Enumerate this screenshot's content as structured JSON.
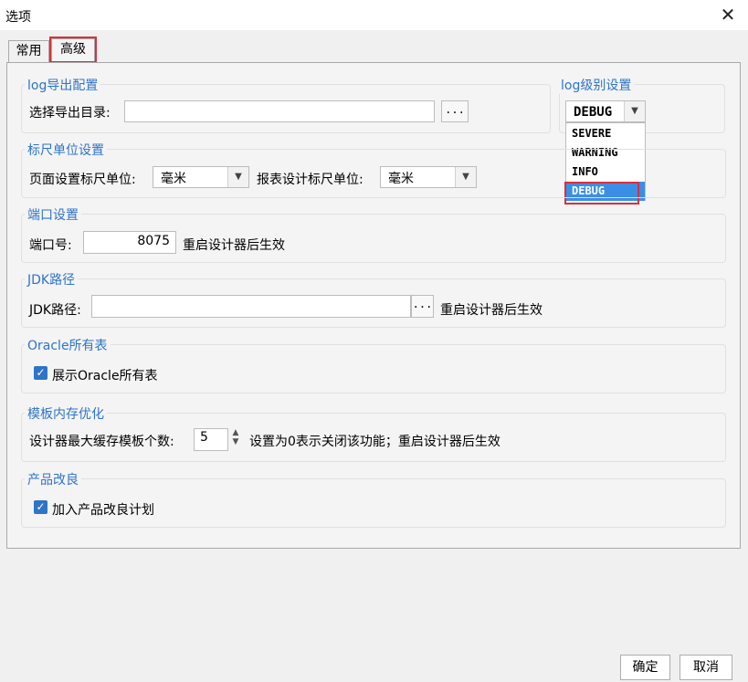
{
  "window": {
    "title": "选项",
    "close_glyph": "✕"
  },
  "tabs": [
    {
      "label": "常用"
    },
    {
      "label": "高级"
    }
  ],
  "log_export": {
    "title": "log导出配置",
    "dir_label": "选择导出目录:",
    "dir_value": "",
    "browse": "..."
  },
  "log_level": {
    "title": "log级别设置",
    "selected": "DEBUG",
    "options": [
      "SEVERE",
      "WARNING",
      "INFO",
      "DEBUG"
    ]
  },
  "ruler": {
    "title": "标尺单位设置",
    "page_label": "页面设置标尺单位:",
    "page_value": "毫米",
    "report_label": "报表设计标尺单位:",
    "report_value": "毫米"
  },
  "port": {
    "title": "端口设置",
    "label": "端口号:",
    "value": "8075",
    "note": "重启设计器后生效"
  },
  "jdk": {
    "title": "JDK路径",
    "label": "JDK路径:",
    "value": "",
    "browse": "...",
    "note": "重启设计器后生效"
  },
  "oracle": {
    "title": "Oracle所有表",
    "checkbox_label": "展示Oracle所有表",
    "checked": true
  },
  "template_mem": {
    "title": "模板内存优化",
    "label": "设计器最大缓存模板个数:",
    "value": "5",
    "note": "设置为0表示关闭该功能；重启设计器后生效"
  },
  "improve": {
    "title": "产品改良",
    "checkbox_label": "加入产品改良计划",
    "checked": true
  },
  "footer": {
    "ok": "确定",
    "cancel": "取消"
  },
  "colors": {
    "accent": "#2e74c7",
    "highlight": "#d9303a",
    "selection": "#3a8ee6"
  }
}
